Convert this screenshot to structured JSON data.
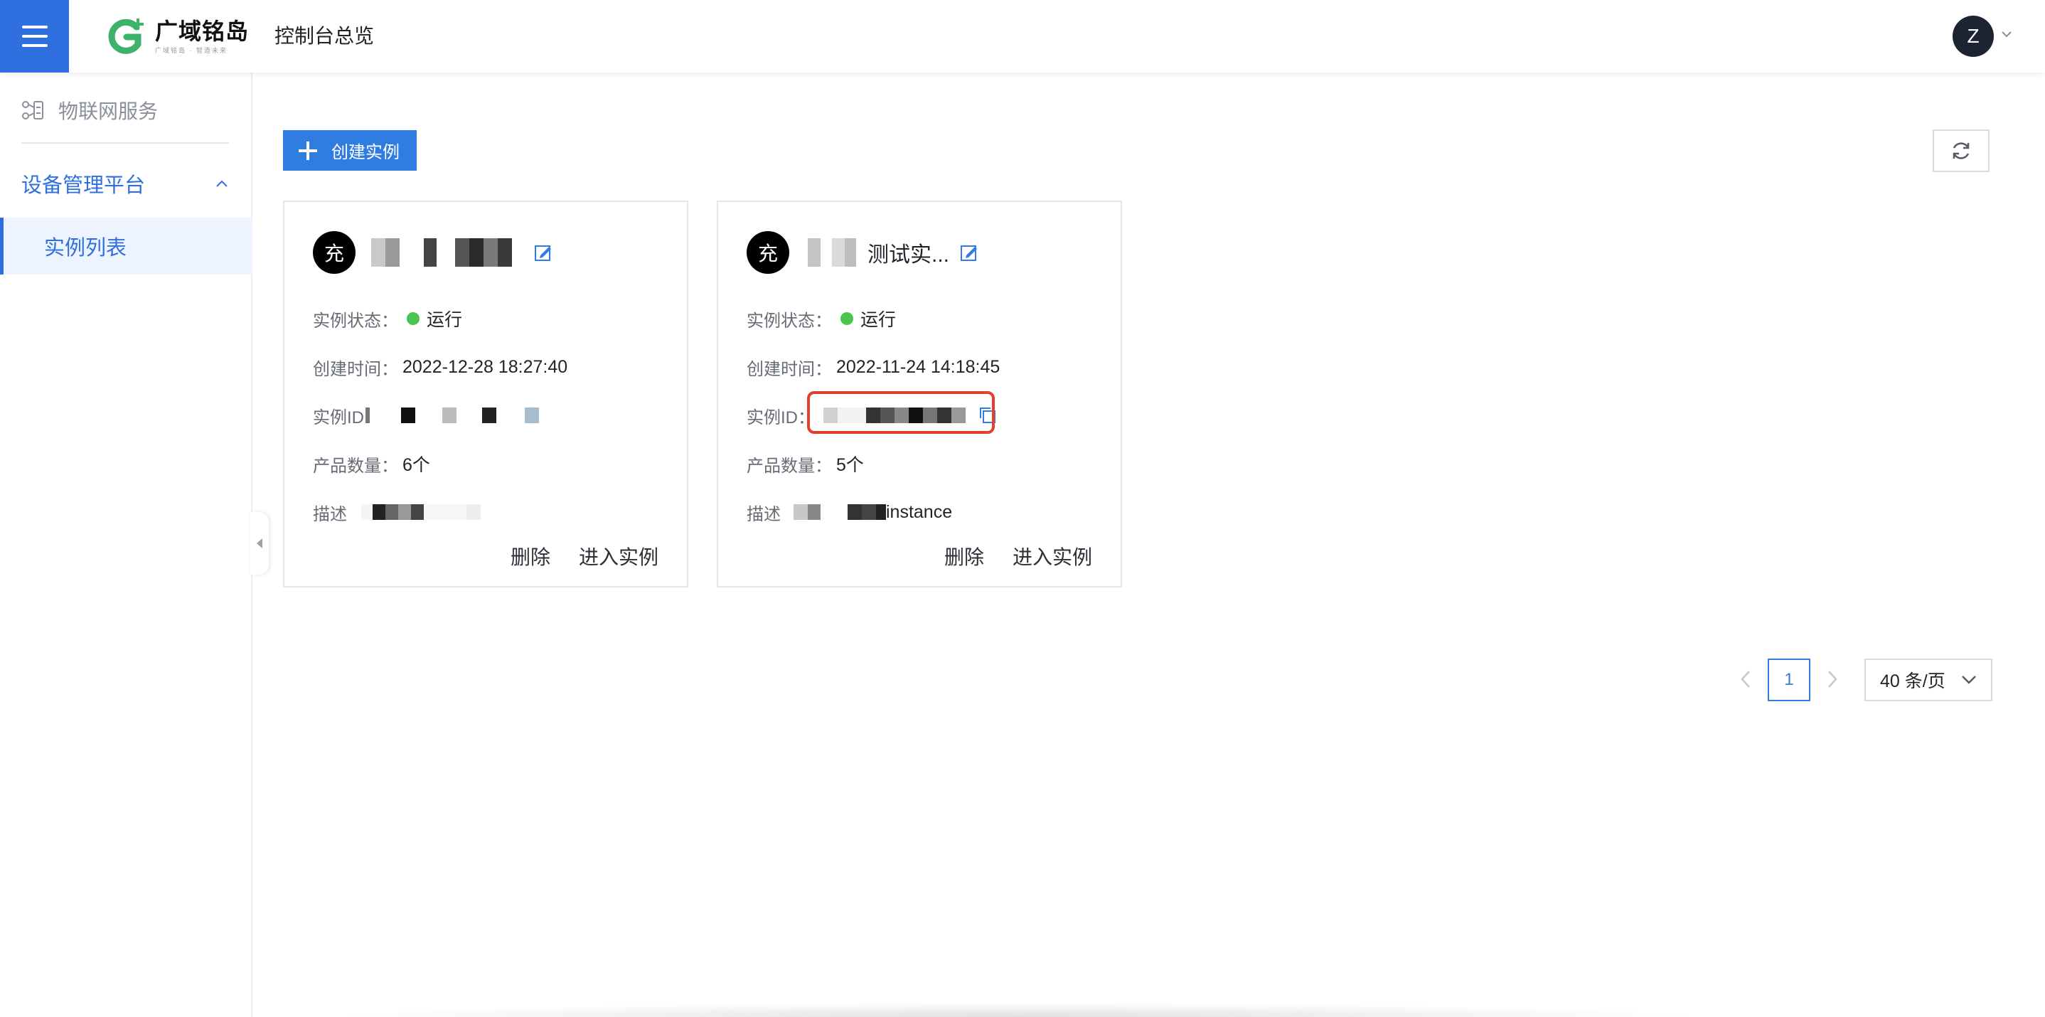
{
  "header": {
    "menu_icon": "hamburger-menu-icon",
    "logo_name": "广域铭岛",
    "logo_slogan": "广域铭岛 · 智造未来",
    "console_title": "控制台总览",
    "user_initial": "Z",
    "accent_color": "#2f6fe0"
  },
  "sidebar": {
    "top_item": {
      "icon": "iot-nodes-icon",
      "label": "物联网服务"
    },
    "group": {
      "label": "设备管理平台",
      "expanded": true
    },
    "active_item": {
      "label": "实例列表"
    }
  },
  "toolbar": {
    "create_label": "创建实例",
    "refresh_icon": "refresh-icon"
  },
  "cards": [
    {
      "avatar_char": "充",
      "name": "",
      "status_key": "实例状态：",
      "status_value": "运行",
      "created_key": "创建时间：",
      "created_value": "2022-12-28 18:27:40",
      "id_key": "实例ID",
      "product_key": "产品数量：",
      "product_value": "6个",
      "desc_key": "描述",
      "desc_value": "",
      "delete_label": "删除",
      "enter_label": "进入实例"
    },
    {
      "avatar_char": "充",
      "name": "测试实...",
      "status_key": "实例状态：",
      "status_value": "运行",
      "created_key": "创建时间：",
      "created_value": "2022-11-24 14:18:45",
      "id_key": "实例ID：",
      "product_key": "产品数量：",
      "product_value": "5个",
      "desc_key": "描述",
      "desc_value": "instance",
      "delete_label": "删除",
      "enter_label": "进入实例"
    }
  ],
  "pagination": {
    "current_page": "1",
    "page_size_label": "40 条/页"
  },
  "colors": {
    "status_running": "#4cc34f",
    "highlight_border": "#e3412b",
    "primary_button": "#2f7de1"
  }
}
